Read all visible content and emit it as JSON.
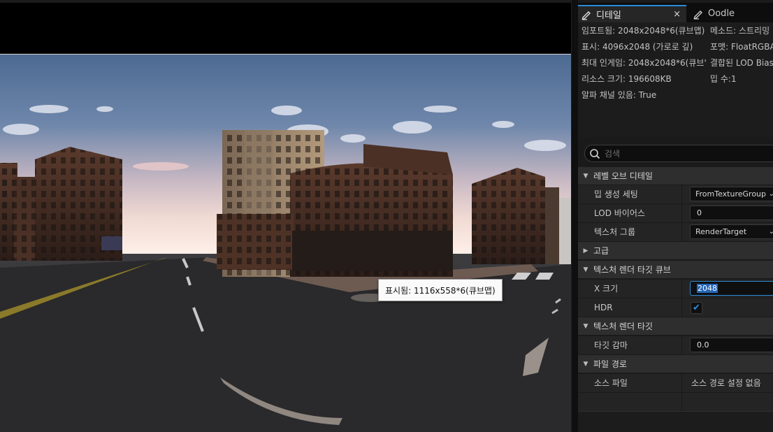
{
  "viewport": {
    "tooltip": "표시됨: 1116x558*6(큐브맵)"
  },
  "tabs": {
    "details": {
      "label": "디테일",
      "close": "×"
    },
    "oodle": {
      "label": "Oodle"
    }
  },
  "info": {
    "imported": "임포트됨: 2048x2048*6(큐브맵)",
    "displayed": "표시: 4096x2048 (가로로 깊)",
    "max_ingame": "최대 인게임: 2048x2048*6(큐브'",
    "resource_size": "리소스 크기: 196608KB",
    "alpha_channel": "알파 채널 있음: True",
    "method": "메소드: 스트리밍",
    "format": "포맷: FloatRGBA",
    "combined_lod": "결합된 LOD Bias",
    "mip_count": "밉 수:1"
  },
  "search": {
    "placeholder": "검색"
  },
  "sections": {
    "level_of_detail": {
      "title": "레벨 오브 디테일",
      "mip_gen_label": "밉 생성 세팅",
      "mip_gen_value": "FromTextureGroup",
      "lod_bias_label": "LOD 바이어스",
      "lod_bias_value": "0",
      "texture_group_label": "텍스처 그룹",
      "texture_group_value": "RenderTarget"
    },
    "advanced": {
      "title": "고급"
    },
    "render_target_cube": {
      "title": "텍스처 렌더 타깃 큐브",
      "size_x_label": "X 크기",
      "size_x_value": "2048",
      "hdr_label": "HDR",
      "hdr_checked": true
    },
    "render_target": {
      "title": "텍스처 렌더 타깃",
      "target_gamma_label": "타깃 감마",
      "target_gamma_value": "0.0"
    },
    "file_path": {
      "title": "파일 경로",
      "source_file_label": "소스 파일",
      "source_file_value": "소스 경로 설정 없음"
    }
  },
  "colors": {
    "accent": "#2a8bd8",
    "panel": "#1a1a1a",
    "section": "#2e2e2e",
    "row": "#242424"
  },
  "icons": {
    "details_tab": "pencil-icon",
    "oodle_tab": "pencil-icon",
    "search": "search-icon",
    "section_expanded": "triangle-down-icon",
    "section_collapsed": "triangle-right-icon",
    "dropdown": "chevron-down-icon",
    "checkbox": "checkmark-icon"
  }
}
